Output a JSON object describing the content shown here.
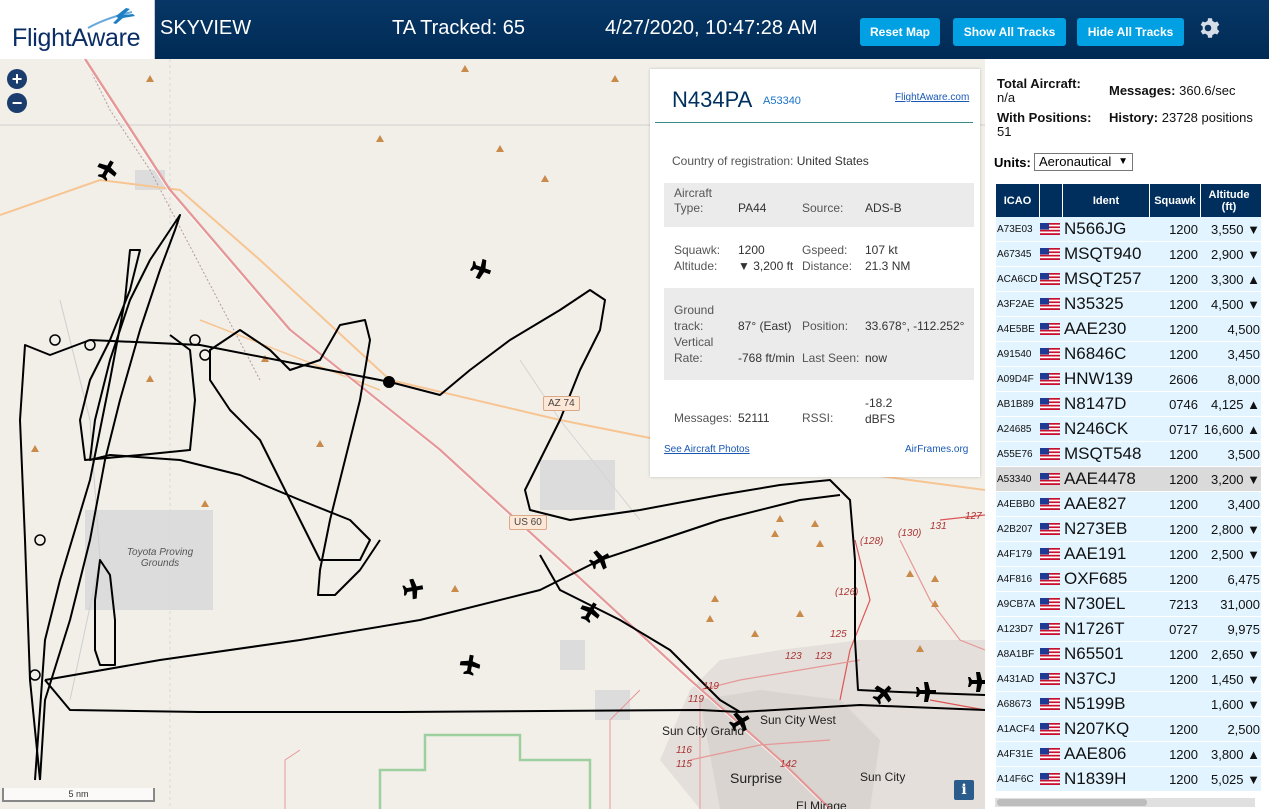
{
  "header": {
    "logo_text": "FlightAware",
    "app_title": "SKYVIEW",
    "tracked": "TA Tracked: 65",
    "datetime": "4/27/2020, 10:47:28 AM",
    "reset_label": "Reset Map",
    "show_label": "Show All Tracks",
    "hide_label": "Hide All Tracks",
    "settings_icon": "gear-icon"
  },
  "map": {
    "zoom_in": "+",
    "zoom_out": "−",
    "scale": "5 nm",
    "info": "i",
    "labels": {
      "proving_grounds": "Toyota Proving Grounds",
      "sun_city_west": "Sun City West",
      "sun_city_grand": "Sun City Grand",
      "surprise": "Surprise",
      "sun_city": "Sun City",
      "el_mirage": "El Mirage",
      "az74": "AZ 74",
      "us60": "US 60"
    },
    "road_numbers": [
      "(128)",
      "(130)",
      "131",
      "127",
      "(126)",
      "125",
      "123",
      "123",
      "119",
      "119",
      "116",
      "115",
      "142"
    ]
  },
  "selected": {
    "registration": "N434PA",
    "icao": "A53340",
    "link": "FlightAware.com",
    "country_label": "Country of registration:",
    "country": "United States",
    "aircraft_type_label": "Aircraft Type:",
    "aircraft_type": "PA44",
    "source_label": "Source:",
    "source": "ADS-B",
    "squawk_label": "Squawk:",
    "squawk": "1200",
    "altitude_label": "Altitude:",
    "altitude": "▼ 3,200 ft",
    "gspeed_label": "Gspeed:",
    "gspeed": "107 kt",
    "distance_label": "Distance:",
    "distance": "21.3 NM",
    "ground_track_label": "Ground track:",
    "ground_track": "87° (East)",
    "position_label": "Position:",
    "position": "33.678°, -112.252°",
    "vertical_rate_label": "Vertical Rate:",
    "vertical_rate": "-768 ft/min",
    "last_seen_label": "Last Seen:",
    "last_seen": "now",
    "messages_label": "Messages:",
    "messages": "52111",
    "rssi_label": "RSSI:",
    "rssi": "-18.2 dBFS",
    "photos": "See Aircraft Photos",
    "airframes": "AirFrames.org"
  },
  "panel": {
    "total_aircraft_label": "Total Aircraft:",
    "total_aircraft": "n/a",
    "messages_label": "Messages:",
    "messages": "360.6/sec",
    "with_positions_label": "With Positions:",
    "with_positions": "51",
    "history_label": "History:",
    "history": "23728 positions",
    "units_label": "Units:",
    "units_value": "Aeronautical"
  },
  "table": {
    "headers": {
      "icao": "ICAO",
      "ident": "Ident",
      "squawk": "Squawk",
      "altitude": "Altitude (ft)"
    },
    "rows": [
      {
        "icao": "A73E03",
        "ident": "N566JG",
        "squawk": "1200",
        "alt": "3,550 ▼"
      },
      {
        "icao": "A67345",
        "ident": "MSQT940",
        "squawk": "1200",
        "alt": "2,900 ▼"
      },
      {
        "icao": "ACA6CD",
        "ident": "MSQT257",
        "squawk": "1200",
        "alt": "3,300 ▲"
      },
      {
        "icao": "A3F2AE",
        "ident": "N35325",
        "squawk": "1200",
        "alt": "4,500 ▼"
      },
      {
        "icao": "A4E5BE",
        "ident": "AAE230",
        "squawk": "1200",
        "alt": "4,500"
      },
      {
        "icao": "A91540",
        "ident": "N6846C",
        "squawk": "1200",
        "alt": "3,450"
      },
      {
        "icao": "A09D4F",
        "ident": "HNW139",
        "squawk": "2606",
        "alt": "8,000"
      },
      {
        "icao": "AB1B89",
        "ident": "N8147D",
        "squawk": "0746",
        "alt": "4,125 ▲"
      },
      {
        "icao": "A24685",
        "ident": "N246CK",
        "squawk": "0717",
        "alt": "16,600 ▲"
      },
      {
        "icao": "A55E76",
        "ident": "MSQT548",
        "squawk": "1200",
        "alt": "3,500"
      },
      {
        "icao": "A53340",
        "ident": "AAE4478",
        "squawk": "1200",
        "alt": "3,200 ▼"
      },
      {
        "icao": "A4EBB0",
        "ident": "AAE827",
        "squawk": "1200",
        "alt": "3,400"
      },
      {
        "icao": "A2B207",
        "ident": "N273EB",
        "squawk": "1200",
        "alt": "2,800 ▼"
      },
      {
        "icao": "A4F179",
        "ident": "AAE191",
        "squawk": "1200",
        "alt": "2,500 ▼"
      },
      {
        "icao": "A4F816",
        "ident": "OXF685",
        "squawk": "1200",
        "alt": "6,475"
      },
      {
        "icao": "A9CB7A",
        "ident": "N730EL",
        "squawk": "7213",
        "alt": "31,000"
      },
      {
        "icao": "A123D7",
        "ident": "N1726T",
        "squawk": "0727",
        "alt": "9,975"
      },
      {
        "icao": "A8A1BF",
        "ident": "N65501",
        "squawk": "1200",
        "alt": "2,650 ▼"
      },
      {
        "icao": "A431AD",
        "ident": "N37CJ",
        "squawk": "1200",
        "alt": "1,450 ▼"
      },
      {
        "icao": "A68673",
        "ident": "N5199B",
        "squawk": "",
        "alt": "1,600 ▼"
      },
      {
        "icao": "A1ACF4",
        "ident": "N207KQ",
        "squawk": "1200",
        "alt": "2,500"
      },
      {
        "icao": "A4F31E",
        "ident": "AAE806",
        "squawk": "1200",
        "alt": "3,800 ▲"
      },
      {
        "icao": "A14F6C",
        "ident": "N1839H",
        "squawk": "1200",
        "alt": "5,025 ▼"
      }
    ],
    "selected_index": 10
  },
  "colors": {
    "header": "#002f5d",
    "button": "#00a0e2",
    "row": "#e2f4ff",
    "row_selected": "#dadada"
  }
}
